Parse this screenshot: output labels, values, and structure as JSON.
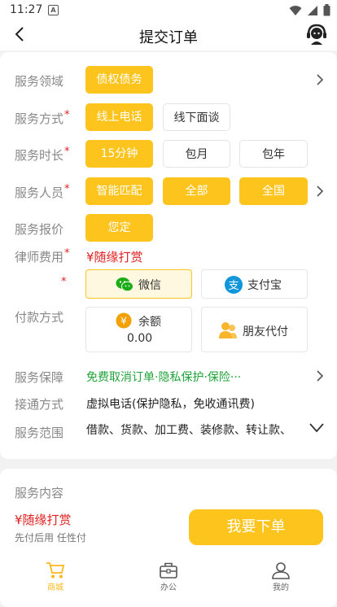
{
  "status_bar": {
    "time": "11:27",
    "notification_icon": "a-badge-icon"
  },
  "header": {
    "title": "提交订单"
  },
  "form": {
    "service_field": {
      "label": "服务领域",
      "value": "债权债务"
    },
    "service_method": {
      "label": "服务方式",
      "options": [
        "线上电话",
        "线下面谈"
      ],
      "selected": "线上电话"
    },
    "service_duration": {
      "label": "服务时长",
      "options": [
        "15分钟",
        "包月",
        "包年"
      ],
      "selected": "15分钟"
    },
    "service_staff": {
      "label": "服务人员",
      "options": [
        "智能匹配",
        "全部",
        "全国"
      ]
    },
    "service_quote": {
      "label": "服务报价",
      "value": "您定"
    },
    "lawyer_fee": {
      "label": "律师费用",
      "value": "¥随缘打赏"
    },
    "payment": {
      "label": "付款方式",
      "wechat": "微信",
      "alipay": "支付宝",
      "balance_label": "余额",
      "balance_value": "0.00",
      "friend_pay": "朋友代付",
      "selected": "微信"
    },
    "guarantee": {
      "label": "服务保障",
      "value": "免费取消订单·隐私保护·保险···"
    },
    "connect_method": {
      "label": "接通方式",
      "value": "虚拟电话(保护隐私，免收通讯费)"
    },
    "service_scope": {
      "label": "服务范围",
      "value": "借款、货款、加工费、装修款、转让款、"
    }
  },
  "content": {
    "label": "服务内容"
  },
  "footer": {
    "price": "¥随缘打赏",
    "note": "先付后用 任性付",
    "submit_label": "我要下单"
  },
  "tabbar": {
    "items": [
      "商城",
      "办公",
      "我的"
    ],
    "active": "商城"
  },
  "colors": {
    "accent": "#fdc41d",
    "required": "#e02020",
    "guarantee": "#21a33a"
  }
}
